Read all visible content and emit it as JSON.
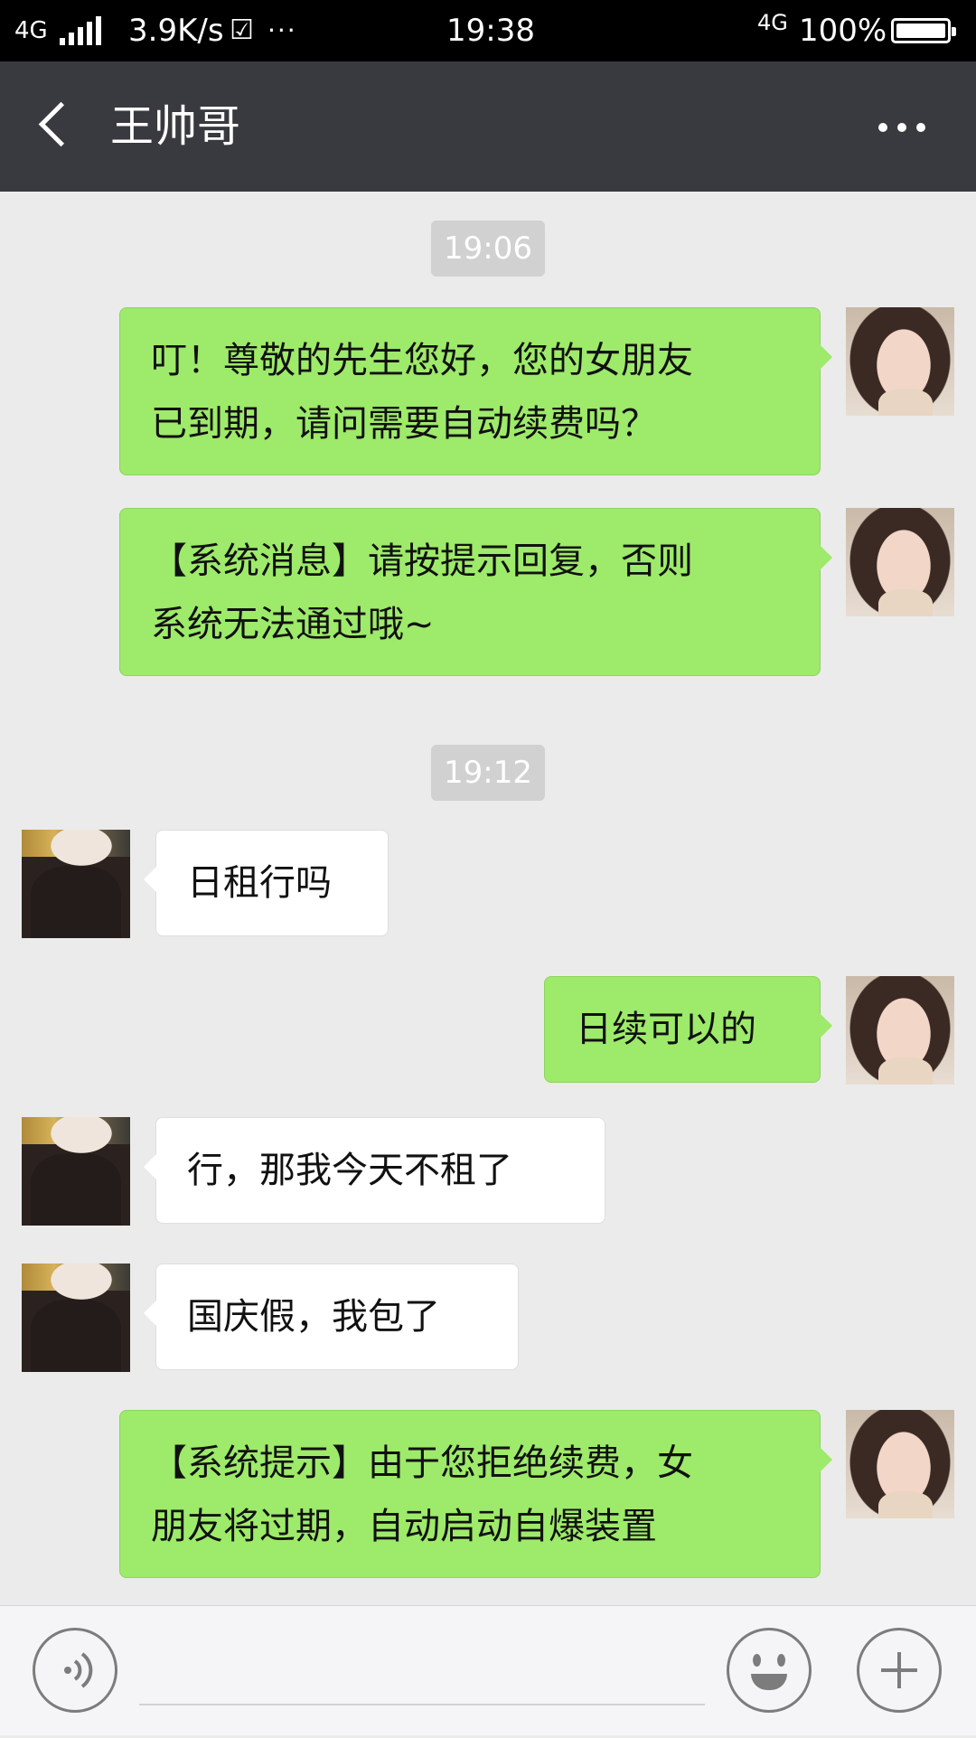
{
  "status_bar": {
    "network": "4G",
    "speed": "3.9K/s",
    "more": "···",
    "time": "19:38",
    "network_right": "4G",
    "battery": "100%"
  },
  "header": {
    "title": "王帅哥",
    "back_icon": "chevron-left-icon",
    "more_icon": "more-dots-icon"
  },
  "messages": {
    "ts1": "19:06",
    "m1": [
      "叮！尊敬的先生您好，您的女朋友",
      "已到期，请问需要自动续费吗？"
    ],
    "m2": [
      "【系统消息】请按提示回复，否则",
      "系统无法通过哦~"
    ],
    "ts2": "19:12",
    "m3": "日租行吗",
    "m4": "日续可以的",
    "m5": "行，那我今天不租了",
    "m6": "国庆假，我包了",
    "m7": [
      "【系统提示】由于您拒绝续费，女",
      "朋友将过期，自动启动自爆装置"
    ]
  },
  "input_bar": {
    "voice_icon": "voice-icon",
    "emoji_icon": "emoji-icon",
    "plus_icon": "plus-icon"
  },
  "colors": {
    "sent_bubble": "#9eea6a",
    "received_bubble": "#ffffff",
    "header_bg": "#393a3f",
    "chat_bg": "#ebebeb"
  }
}
